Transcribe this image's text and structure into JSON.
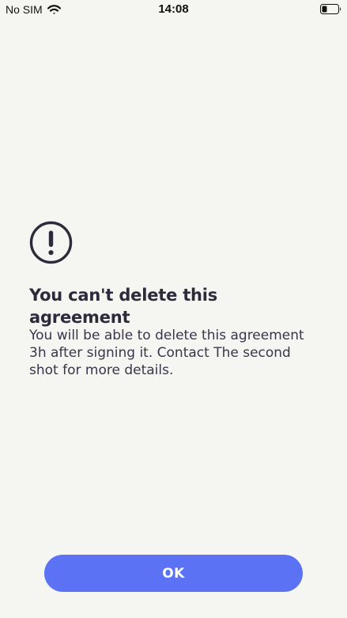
{
  "status_bar": {
    "carrier": "No SIM",
    "time": "14:08",
    "wifi_icon": "wifi-icon",
    "battery_icon": "battery-icon"
  },
  "alert": {
    "icon": "exclamation-circle-icon",
    "title": "You can't delete this agreement",
    "message": "You will be able to delete this agreement 3h after signing it. Contact The second shot for more details."
  },
  "actions": {
    "ok_label": "OK"
  },
  "colors": {
    "background": "#f5f5f1",
    "text_primary": "#2d2a3b",
    "accent": "#5c72f4"
  }
}
